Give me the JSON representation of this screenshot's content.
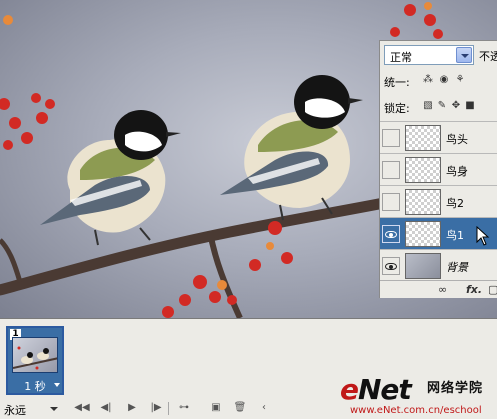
{
  "layers_panel": {
    "blend_mode": "正常",
    "opacity_label": "不透",
    "unify_label": "统一:",
    "lock_label": "锁定:",
    "layers": [
      {
        "name": "鸟头",
        "visible": false,
        "selected": false
      },
      {
        "name": "鸟身",
        "visible": false,
        "selected": false
      },
      {
        "name": "鸟2",
        "visible": false,
        "selected": false
      },
      {
        "name": "鸟1",
        "visible": true,
        "selected": true
      },
      {
        "name": "背景",
        "visible": true,
        "selected": false
      }
    ],
    "footer_fx": "fx."
  },
  "animation_panel": {
    "frame_number": "1",
    "frame_delay": "1 秒",
    "loop_label": "永远"
  },
  "watermark": {
    "logo_e": "e",
    "logo_net": "Net",
    "chinese": "网络学院",
    "url": "www.eNet.com.cn/eschool"
  },
  "colors": {
    "selection_blue": "#3a6ea5",
    "panel_bg": "#ecebe6",
    "brand_red": "#c01818"
  }
}
